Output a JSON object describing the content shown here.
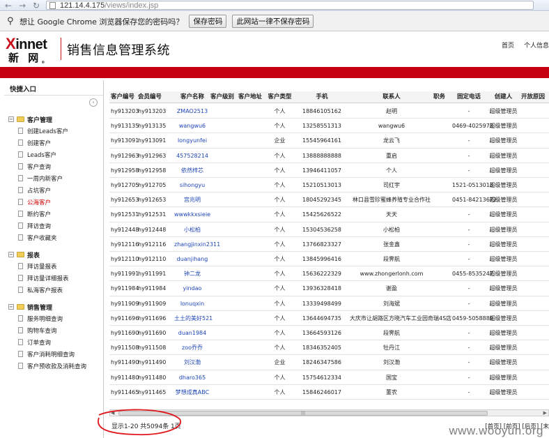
{
  "browser": {
    "url_host": "121.14.4.175",
    "url_path": "/views/index.jsp"
  },
  "infobar": {
    "message": "想让 Google Chrome 浏览器保存您的密码吗？",
    "save_label": "保存密码",
    "never_label": "此网站一律不保存密码"
  },
  "header": {
    "logo_en": "Xinnet",
    "logo_cn": "新 网",
    "system_title": "销售信息管理系统",
    "links": [
      "首页",
      "个人信息"
    ]
  },
  "sidebar": {
    "title": "快捷入口",
    "groups": [
      {
        "label": "客户管理",
        "items": [
          "创建Leads客户",
          "创建客户",
          "Leads客户",
          "客户查询",
          "一周内新客户",
          "占坑客户",
          "公海客户",
          "断约客户",
          "拜访查询",
          "客户收藏夹"
        ]
      },
      {
        "label": "报表",
        "items": [
          "拜访量报表",
          "拜访量详细报表",
          "私海客户报表"
        ]
      },
      {
        "label": "销售管理",
        "items": [
          "服务明细查询",
          "购物车查询",
          "订单查询",
          "客户消耗明细查询",
          "客户预收款及消耗查询"
        ]
      }
    ]
  },
  "table": {
    "columns": [
      "客户编号",
      "会员编号",
      "客户名称",
      "客户级别",
      "客户地址",
      "客户类型",
      "手机",
      "联系人",
      "职务",
      "固定电话",
      "创建人",
      "开放原因"
    ],
    "rows": [
      [
        "hy913203",
        "hy913203",
        "ZMAO2513",
        "",
        "",
        "个人",
        "18846105162",
        "赵明",
        "",
        "-",
        "超级管理员"
      ],
      [
        "hy913135",
        "hy913135",
        "wangwu6",
        "",
        "",
        "个人",
        "13258551313",
        "wangwu6",
        "",
        "0469-4025973",
        "超级管理员"
      ],
      [
        "hy913091",
        "hy913091",
        "longyunfei",
        "",
        "",
        "企业",
        "15545964161",
        "龙云飞",
        "",
        "-",
        "超级管理员"
      ],
      [
        "hy912963",
        "hy912963",
        "457528214",
        "",
        "",
        "个人",
        "13888888888",
        "重启",
        "",
        "-",
        "超级管理员"
      ],
      [
        "hy912958",
        "hy912958",
        "依然梓芯",
        "",
        "",
        "个人",
        "13946411057",
        "个人",
        "",
        "-",
        "超级管理员"
      ],
      [
        "hy912705",
        "hy912705",
        "sihongyu",
        "",
        "",
        "个人",
        "15210513013",
        "司红宇",
        "",
        "1521-0513013",
        "超级管理员"
      ],
      [
        "hy912653",
        "hy912653",
        "宫兆明",
        "",
        "",
        "个人",
        "18045292345",
        "林口县雪珍蜜蜂养殖专业合作社",
        "",
        "0451-84213672",
        "超级管理员"
      ],
      [
        "hy912531",
        "hy912531",
        "wwwkkxsieie",
        "",
        "",
        "个人",
        "15425626522",
        "天天",
        "",
        "-",
        "超级管理员"
      ],
      [
        "hy912448",
        "hy912448",
        "小松柏",
        "",
        "",
        "个人",
        "15304536258",
        "小松柏",
        "",
        "-",
        "超级管理员"
      ],
      [
        "hy912116",
        "hy912116",
        "zhangjinxin2311",
        "",
        "",
        "个人",
        "13766823327",
        "张金鑫",
        "",
        "-",
        "超级管理员"
      ],
      [
        "hy912110",
        "hy912110",
        "duanjihang",
        "",
        "",
        "个人",
        "13845996416",
        "段霁航",
        "",
        "-",
        "超级管理员"
      ],
      [
        "hy911991",
        "hy911991",
        "钟二龙",
        "",
        "",
        "个人",
        "15636222329",
        "www.zhongerlonh.com",
        "",
        "0455-8535247",
        "超级管理员"
      ],
      [
        "hy911984",
        "hy911984",
        "yindao",
        "",
        "",
        "个人",
        "13936328418",
        "谢盈",
        "",
        "-",
        "超级管理员"
      ],
      [
        "hy911909",
        "hy911909",
        "lonuqxin",
        "",
        "",
        "个人",
        "13339498499",
        "刘海斌",
        "",
        "-",
        "超级管理员"
      ],
      [
        "hy911696",
        "hy911696",
        "土土的美好521",
        "",
        "",
        "个人",
        "13644694735",
        "大庆市让胡路区方晓汽车工业园奇瑞4S店",
        "",
        "0459-5058889",
        "超级管理员"
      ],
      [
        "hy911690",
        "hy911690",
        "duan1984",
        "",
        "",
        "个人",
        "13664593126",
        "段霁航",
        "",
        "-",
        "超级管理员"
      ],
      [
        "hy911508",
        "hy911508",
        "zoo乔乔",
        "",
        "",
        "个人",
        "18346352405",
        "牡丹江",
        "",
        "-",
        "超级管理员"
      ],
      [
        "hy911490",
        "hy911490",
        "刘汉渤",
        "",
        "",
        "企业",
        "18246347586",
        "刘汉渤",
        "",
        "-",
        "超级管理员"
      ],
      [
        "hy911480",
        "hy911480",
        "dharo365",
        "",
        "",
        "个人",
        "15754612334",
        "国宝",
        "",
        "-",
        "超级管理员"
      ],
      [
        "hy911465",
        "hy911465",
        "梦想成真ABC",
        "",
        "",
        "个人",
        "15846246017",
        "董农",
        "",
        "-",
        "超级管理员"
      ]
    ]
  },
  "footer": {
    "status": "显示1-20 共5094条 1页",
    "pager": [
      "[首页]",
      "[前页]",
      "[后页]",
      "[末"
    ]
  },
  "watermark": "www.wooyun.org"
}
